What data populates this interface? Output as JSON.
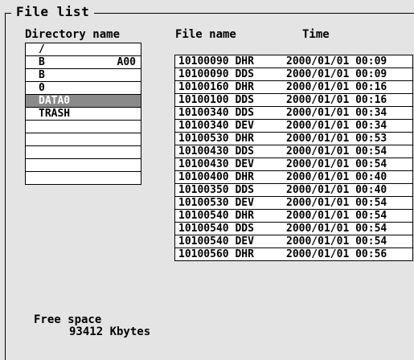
{
  "panel": {
    "title": "File list"
  },
  "directory": {
    "header": "Directory name",
    "items": [
      {
        "name": "/",
        "extra": ""
      },
      {
        "name": "B",
        "extra": "A00"
      },
      {
        "name": "B",
        "extra": ""
      },
      {
        "name": "0",
        "extra": ""
      },
      {
        "name": "DATA0",
        "extra": "",
        "selected": true
      },
      {
        "name": "TRASH",
        "extra": ""
      },
      {
        "name": "",
        "extra": ""
      },
      {
        "name": "",
        "extra": ""
      },
      {
        "name": "",
        "extra": ""
      },
      {
        "name": "",
        "extra": ""
      },
      {
        "name": "",
        "extra": ""
      }
    ]
  },
  "files": {
    "name_header": "File name",
    "time_header": "Time",
    "rows": [
      {
        "name": "10100090 DHR",
        "time": "2000/01/01 00:09"
      },
      {
        "name": "10100090 DDS",
        "time": "2000/01/01 00:09"
      },
      {
        "name": "10100160 DHR",
        "time": "2000/01/01 00:16"
      },
      {
        "name": "10100100 DDS",
        "time": "2000/01/01 00:16"
      },
      {
        "name": "10100340 DDS",
        "time": "2000/01/01 00:34"
      },
      {
        "name": "10100340 DEV",
        "time": "2000/01/01 00:34"
      },
      {
        "name": "10100530 DHR",
        "time": "2000/01/01 00:53"
      },
      {
        "name": "10100430 DDS",
        "time": "2000/01/01 00:54"
      },
      {
        "name": "10100430 DEV",
        "time": "2000/01/01 00:54"
      },
      {
        "name": "10100400 DHR",
        "time": "2000/01/01 00:40"
      },
      {
        "name": "10100350 DDS",
        "time": "2000/01/01 00:40"
      },
      {
        "name": "10100530 DEV",
        "time": "2000/01/01 00:54"
      },
      {
        "name": "10100540 DHR",
        "time": "2000/01/01 00:54"
      },
      {
        "name": "10100540 DDS",
        "time": "2000/01/01 00:54"
      },
      {
        "name": "10100540 DEV",
        "time": "2000/01/01 00:54"
      },
      {
        "name": "10100560 DHR",
        "time": "2000/01/01 00:56"
      }
    ]
  },
  "free_space": {
    "label": "Free space",
    "value": "93412 Kbytes"
  }
}
